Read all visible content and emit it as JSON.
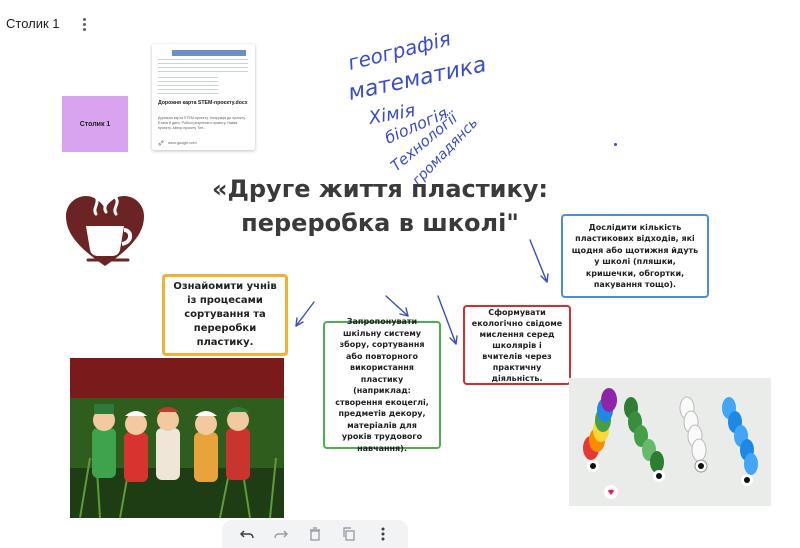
{
  "board": {
    "title": "Столик 1"
  },
  "doc_card": {
    "title": "Дорожня карта STEM-проєкту.docx",
    "snippet": "Дорожня карта STEM-проєкту. Інструкція до проєкту. Етапи й дати. Робочі результати проєкту. Назва проєкту. Автор проєкту Тел...",
    "link": "docs.google.com"
  },
  "sticky": {
    "label": "Столик 1"
  },
  "title": {
    "line1": "«Друге життя пластику:",
    "line2": "переробка в школі\""
  },
  "handwriting": [
    "географія",
    "математика",
    "Хімія",
    "біологія",
    "Технології",
    "громадянсь"
  ],
  "boxes": {
    "orange": "Ознайомити учнів із процесами сортування та переробки пластику.",
    "green": "Запропонувати шкільну систему збору, сортування або повторного використання пластику (наприклад: створення екоцеглі, предметів декору, матеріалів для уроків трудового навчання).",
    "red": "Сформувати екологічно свідоме мислення серед школярів і вчителів через практичну діяльність.",
    "blue": "Дослідити кількість пластикових відходів, які щодня або щотижня йдуть у школі (пляшки, кришечки, обгортки, пакування тощо)."
  },
  "colors": {
    "orange": "#f2b134",
    "green": "#4caf50",
    "red": "#d32f2f",
    "blue": "#4a90d9",
    "sticky": "#d9a3f0",
    "ink": "#3b4cc8"
  },
  "toolbar": {
    "icons": [
      "undo-icon",
      "redo-icon",
      "delete-icon",
      "copy-icon",
      "more-vert-icon"
    ]
  }
}
